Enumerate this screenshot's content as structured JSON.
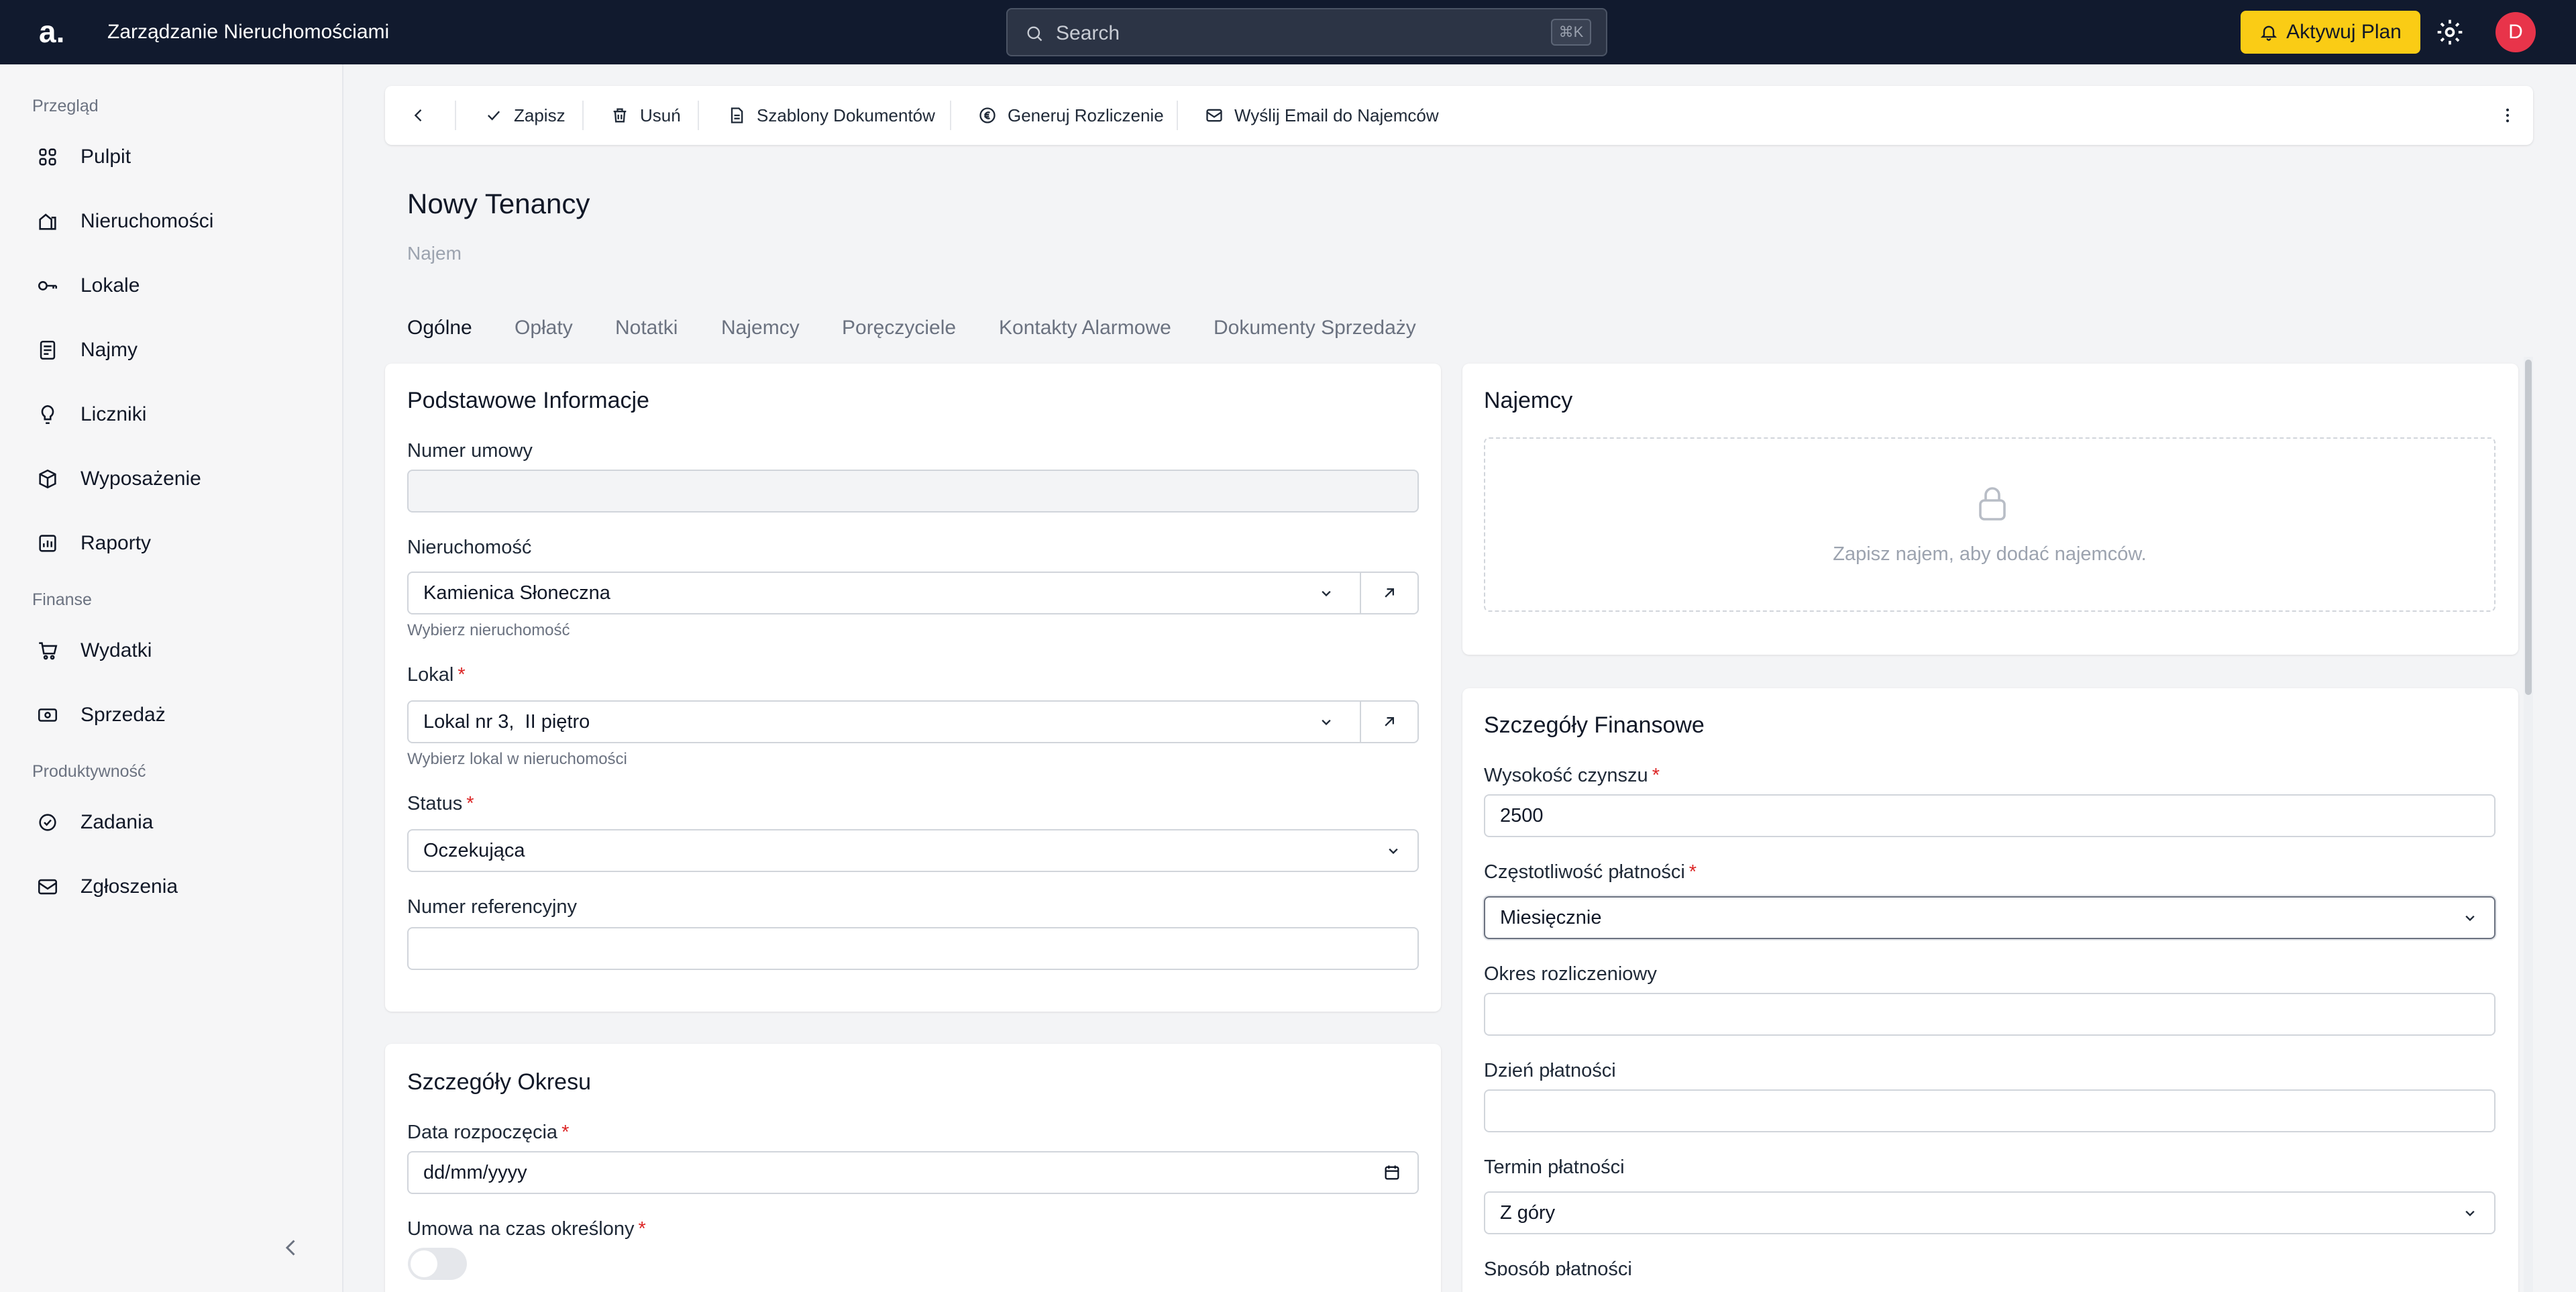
{
  "topbar": {
    "logo": "a.",
    "app_title": "Zarządzanie Nieruchomościami",
    "search_placeholder": "Search",
    "search_shortcut": "⌘K",
    "upgrade_label": "Aktywuj Plan",
    "avatar_initial": "D",
    "upgrade_color": "#facc15",
    "avatar_color": "#e8344a"
  },
  "sidebar": {
    "sections": [
      {
        "label": "Przegląd",
        "items": [
          {
            "label": "Pulpit",
            "icon": "grid-icon"
          },
          {
            "label": "Nieruchomości",
            "icon": "building-icon"
          },
          {
            "label": "Lokale",
            "icon": "key-icon"
          },
          {
            "label": "Najmy",
            "icon": "document-icon"
          },
          {
            "label": "Liczniki",
            "icon": "bulb-icon"
          },
          {
            "label": "Wyposażenie",
            "icon": "box-icon"
          },
          {
            "label": "Raporty",
            "icon": "chart-icon"
          }
        ]
      },
      {
        "label": "Finanse",
        "items": [
          {
            "label": "Wydatki",
            "icon": "cart-icon"
          },
          {
            "label": "Sprzedaż",
            "icon": "money-icon"
          }
        ]
      },
      {
        "label": "Produktywność",
        "items": [
          {
            "label": "Zadania",
            "icon": "check-circle-icon"
          },
          {
            "label": "Zgłoszenia",
            "icon": "mail-icon"
          }
        ]
      }
    ]
  },
  "toolbar": {
    "save": "Zapisz",
    "delete": "Usuń",
    "templates": "Szablony Dokumentów",
    "settlement": "Generuj Rozliczenie",
    "email": "Wyślij Email do Najemców"
  },
  "page": {
    "title": "Nowy Tenancy",
    "subtitle": "Najem"
  },
  "tabs": [
    "Ogólne",
    "Opłaty",
    "Notatki",
    "Najemcy",
    "Poręczyciele",
    "Kontakty Alarmowe",
    "Dokumenty Sprzedaży"
  ],
  "basic": {
    "title": "Podstawowe Informacje",
    "contract_number_label": "Numer umowy",
    "contract_number_value": "",
    "property_label": "Nieruchomość",
    "property_value": "Kamienica Słoneczna",
    "property_hint": "Wybierz nieruchomość",
    "unit_label": "Lokal",
    "unit_value": "Lokal nr 3,  II piętro",
    "unit_hint": "Wybierz lokal w nieruchomości",
    "status_label": "Status",
    "status_value": "Oczekująca",
    "reference_label": "Numer referencyjny",
    "reference_value": ""
  },
  "period": {
    "title": "Szczegóły Okresu",
    "start_label": "Data rozpoczęcia",
    "start_placeholder": "dd/mm/yyyy",
    "fixed_term_label": "Umowa na czas określony",
    "fixed_term_on": false
  },
  "tenants": {
    "title": "Najemcy",
    "empty_message": "Zapisz najem, aby dodać najemców."
  },
  "finance": {
    "title": "Szczegóły Finansowe",
    "rent_label": "Wysokość czynszu",
    "rent_value": "2500",
    "frequency_label": "Częstotliwość płatności",
    "frequency_value": "Miesięcznie",
    "period_label": "Okres rozliczeniowy",
    "period_value": "",
    "payment_day_label": "Dzień płatności",
    "payment_day_value": "",
    "due_label": "Termin płatności",
    "due_value": "Z góry",
    "method_label": "Sposób płatności"
  },
  "required_mark": "*"
}
